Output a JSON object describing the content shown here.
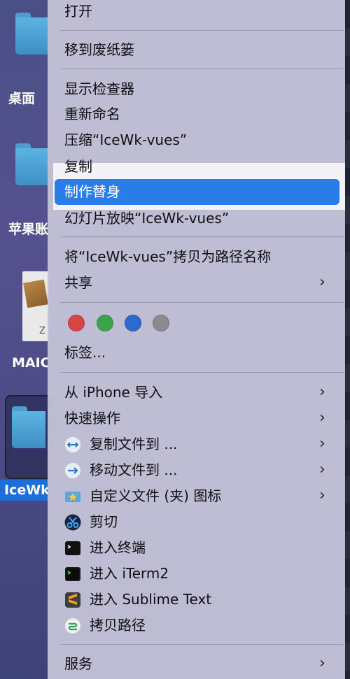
{
  "desktop": {
    "items": [
      {
        "label": "桌面"
      },
      {
        "label": "苹果账"
      },
      {
        "label": "MAIC"
      },
      {
        "label": "IceWk"
      }
    ],
    "zip_letter": "Z"
  },
  "menu": {
    "open": "打开",
    "trash": "移到废纸篓",
    "inspector": "显示检查器",
    "rename": "重新命名",
    "compress": "压缩“IceWk-vues”",
    "copy": "复制",
    "alias": "制作替身",
    "slideshow": "幻灯片放映“IceWk-vues”",
    "copy_path_name": "将“IceWk-vues”拷贝为路径名称",
    "share": "共享",
    "tags_label": "标签...",
    "tag_colors": [
      "#d94545",
      "#3aa34c",
      "#2a6bd0",
      "#8a8a8f"
    ],
    "import_iphone": "从 iPhone 导入",
    "quick_actions": "快速操作",
    "copy_files_to": "复制文件到 ...",
    "move_files_to": "移动文件到 ...",
    "custom_icon": "自定义文件 (夹) 图标",
    "cut": "剪切",
    "terminal": "进入终端",
    "iterm": "进入 iTerm2",
    "sublime": "进入 Sublime Text",
    "copy_path": "拷贝路径",
    "services": "服务",
    "chevron": "›"
  }
}
